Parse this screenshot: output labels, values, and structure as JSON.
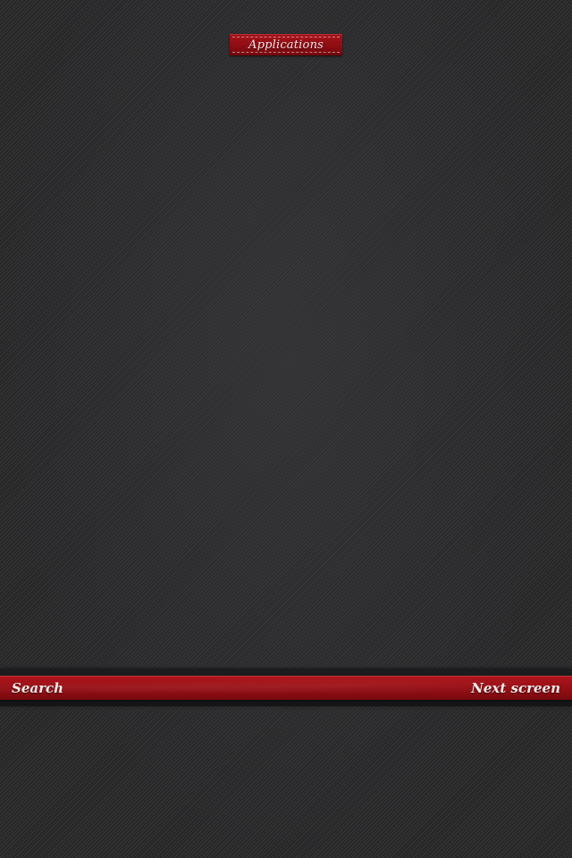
{
  "header": {
    "title": "Applications"
  },
  "bottom_bar": {
    "search_label": "Search",
    "next_label": "Next screen"
  },
  "colors": {
    "ribbon_red": "#9c1017",
    "background": "#2c2c2e",
    "text": "#f3e9e9"
  }
}
